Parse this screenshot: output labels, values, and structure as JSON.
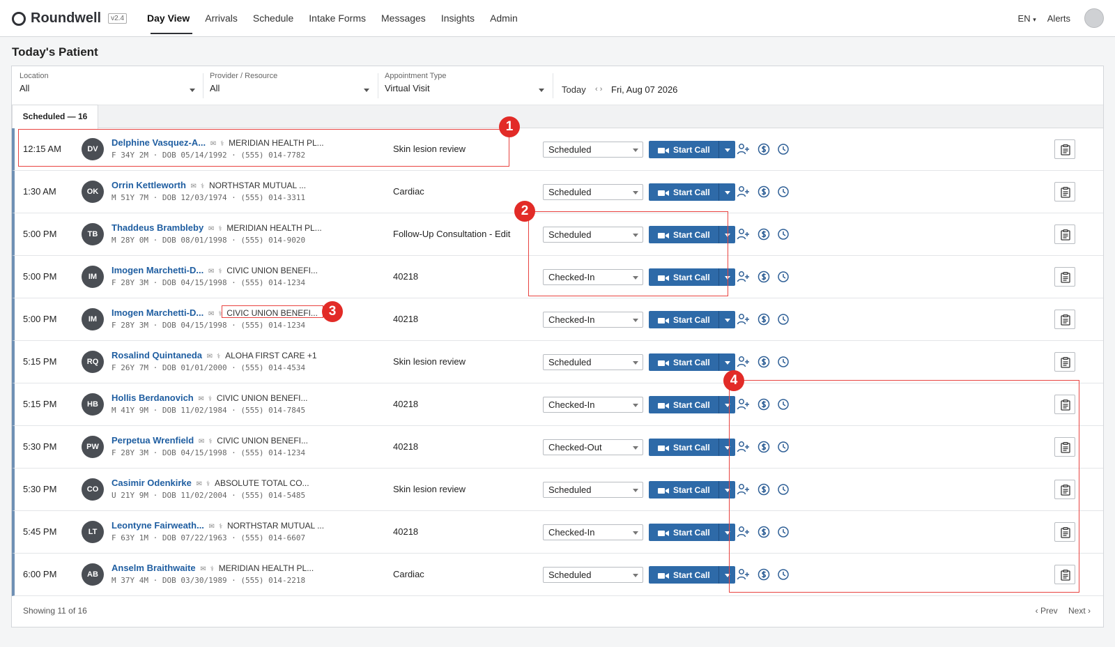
{
  "app": {
    "name": "Roundwell",
    "version": "v2.4"
  },
  "nav": [
    {
      "label": "Day View",
      "active": true
    },
    {
      "label": "Arrivals"
    },
    {
      "label": "Schedule"
    },
    {
      "label": "Intake Forms"
    },
    {
      "label": "Messages"
    },
    {
      "label": "Insights"
    },
    {
      "label": "Admin"
    }
  ],
  "topbar": {
    "language": "EN",
    "alerts": "Alerts"
  },
  "page_title": "Today's Patient",
  "filters": {
    "location": {
      "label": "Location",
      "value": "All"
    },
    "provider": {
      "label": "Provider / Resource",
      "value": "All"
    },
    "appointment_type": {
      "label": "Appointment Type",
      "value": "Virtual Visit"
    },
    "date": {
      "today": "Today",
      "arrows": "‹ ›",
      "value": "Fri, Aug 07 2026"
    }
  },
  "tab": {
    "label": "Scheduled — 16"
  },
  "call_label": "Start Call",
  "rows": [
    {
      "time": "12:15 AM",
      "initials": "DV",
      "name": "Delphine Vasquez-A...",
      "insurer": "MERIDIAN HEALTH PL...",
      "details": "F 34Y 2M · DOB 05/14/1992 · (555) 014-7782",
      "appointment": "Skin lesion review",
      "status": "Scheduled"
    },
    {
      "time": "1:30 AM",
      "initials": "OK",
      "name": "Orrin Kettleworth",
      "insurer": "NORTHSTAR MUTUAL ...",
      "details": "M 51Y 7M · DOB 12/03/1974 · (555) 014-3311",
      "appointment": "Cardiac",
      "status": "Scheduled"
    },
    {
      "time": "5:00 PM",
      "initials": "TB",
      "name": "Thaddeus Brambleby",
      "insurer": "MERIDIAN HEALTH PL...",
      "details": "M 28Y 0M · DOB 08/01/1998 · (555) 014-9020",
      "appointment": "Follow-Up Consultation - Edit",
      "status": "Scheduled"
    },
    {
      "time": "5:00 PM",
      "initials": "IM",
      "name": "Imogen Marchetti-D...",
      "insurer": "CIVIC UNION BENEFI...",
      "details": "F 28Y 3M · DOB 04/15/1998 · (555) 014-1234",
      "appointment": "40218",
      "status": "Checked-In"
    },
    {
      "time": "5:00 PM",
      "initials": "IM",
      "name": "Imogen Marchetti-D...",
      "insurer": "CIVIC UNION BENEFI...",
      "details": "F 28Y 3M · DOB 04/15/1998 · (555) 014-1234",
      "appointment": "40218",
      "status": "Checked-In"
    },
    {
      "time": "5:15 PM",
      "initials": "RQ",
      "name": "Rosalind Quintaneda",
      "insurer": "ALOHA FIRST CARE +1",
      "details": "F 26Y 7M · DOB 01/01/2000 · (555) 014-4534",
      "appointment": "Skin lesion review",
      "status": "Scheduled"
    },
    {
      "time": "5:15 PM",
      "initials": "HB",
      "name": "Hollis Berdanovich",
      "insurer": "CIVIC UNION BENEFI...",
      "details": "M 41Y 9M · DOB 11/02/1984 · (555) 014-7845",
      "appointment": "40218",
      "status": "Checked-In"
    },
    {
      "time": "5:30 PM",
      "initials": "PW",
      "name": "Perpetua Wrenfield",
      "insurer": "CIVIC UNION BENEFI...",
      "details": "F 28Y 3M · DOB 04/15/1998 · (555) 014-1234",
      "appointment": "40218",
      "status": "Checked-Out"
    },
    {
      "time": "5:30 PM",
      "initials": "CO",
      "name": "Casimir Odenkirke",
      "insurer": "ABSOLUTE TOTAL CO...",
      "details": "U 21Y 9M · DOB 11/02/2004 · (555) 014-5485",
      "appointment": "Skin lesion review",
      "status": "Scheduled"
    },
    {
      "time": "5:45 PM",
      "initials": "LT",
      "name": "Leontyne Fairweath...",
      "insurer": "NORTHSTAR MUTUAL ...",
      "details": "F 63Y 1M · DOB 07/22/1963 · (555) 014-6607",
      "appointment": "40218",
      "status": "Checked-In"
    },
    {
      "time": "6:00 PM",
      "initials": "AB",
      "name": "Anselm Braithwaite",
      "insurer": "MERIDIAN HEALTH PL...",
      "details": "M 37Y 4M · DOB 03/30/1989 · (555) 014-2218",
      "appointment": "Cardiac",
      "status": "Scheduled"
    }
  ],
  "footer": {
    "showing": "Showing 11 of 16",
    "prev": "‹ Prev",
    "next": "Next ›"
  },
  "annotations": [
    "1",
    "2",
    "3",
    "4"
  ],
  "colors": {
    "accent": "#2e6aa8",
    "link": "#1f5ea1",
    "annotation": "#e22b27",
    "row_stripe": "#6f90b4"
  }
}
